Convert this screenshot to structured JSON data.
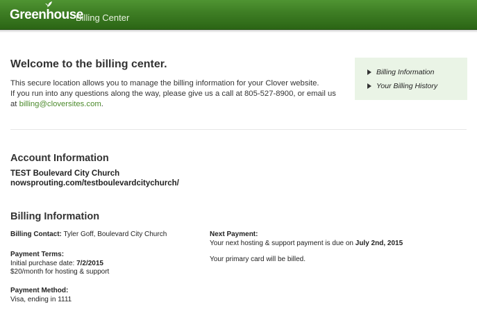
{
  "header": {
    "logo_text": "Greenhouse",
    "subtitle": "Billing Center",
    "colors": {
      "header_green": "#3f7f25",
      "link_green": "#4b8a2b",
      "nav_bg": "#eaf4e6"
    }
  },
  "welcome": {
    "title": "Welcome to the billing center.",
    "line1": "This secure location allows you to manage the billing information for your Clover website.",
    "line2": "If you run into any questions along the way, please give us a call at 805-527-8900, or email us",
    "line3_prefix": "at ",
    "email": "billing@cloversites.com",
    "line3_suffix": "."
  },
  "sidenav": {
    "items": [
      {
        "label": "Billing Information",
        "icon": "triangle-right-icon"
      },
      {
        "label": "Your Billing History",
        "icon": "triangle-right-icon"
      }
    ]
  },
  "account": {
    "title": "Account Information",
    "name": "TEST Boulevard City Church",
    "url": "nowsprouting.com/testboulevardcitychurch/"
  },
  "billing": {
    "title": "Billing Information",
    "contact_label": "Billing Contact:",
    "contact_value": "Tyler Goff, Boulevard City Church",
    "terms_label": "Payment Terms:",
    "initial_purchase_prefix": "Initial purchase date: ",
    "initial_purchase_date": "7/2/2015",
    "rate": "$20/month for hosting & support",
    "method_label": "Payment Method:",
    "method_value": "Visa, ending in 1111",
    "next_label": "Next Payment:",
    "next_prefix": "Your next hosting & support payment is due on ",
    "next_date": "July 2nd, 2015",
    "card_note": "Your primary card will be billed."
  }
}
